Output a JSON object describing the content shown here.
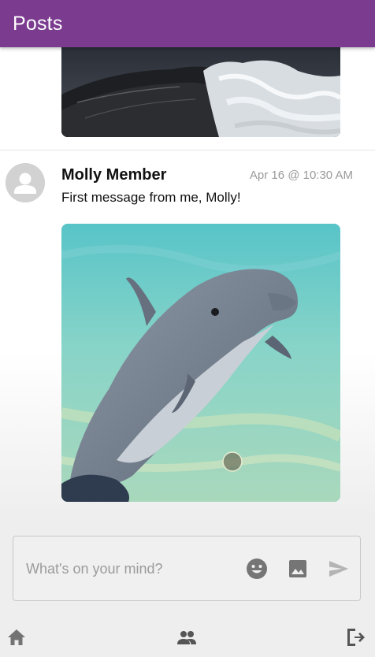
{
  "app_bar": {
    "title": "Posts",
    "color": "#7b3b8f"
  },
  "feed": {
    "previous_post": {
      "image": "ocean-wave-photo"
    },
    "posts": [
      {
        "author": "Molly Member",
        "timestamp": "Apr 16 @ 10:30 AM",
        "text": "First message from me, Molly!",
        "image": "dolphin-photo",
        "avatar": "default-person-avatar"
      }
    ]
  },
  "composer": {
    "placeholder": "What's on your mind?",
    "icons": [
      "emoji-icon",
      "image-icon",
      "send-icon"
    ]
  },
  "bottom_nav": {
    "items": [
      "home-icon",
      "people-icon",
      "logout-icon"
    ]
  }
}
